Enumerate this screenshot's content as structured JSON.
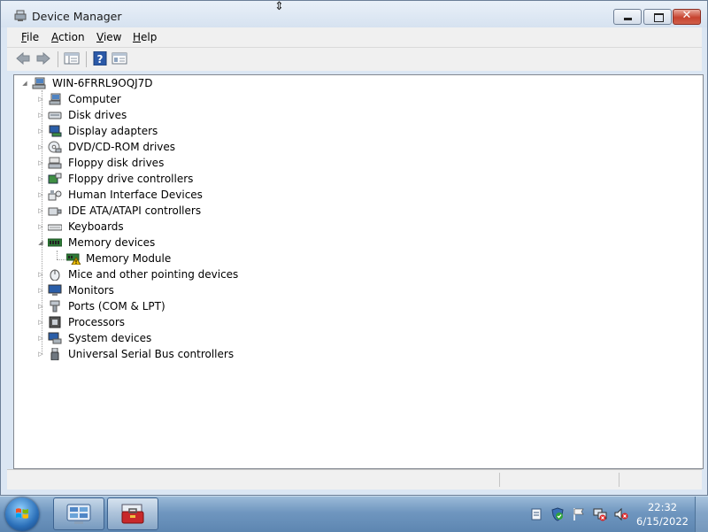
{
  "window": {
    "title": "Device Manager",
    "controls": {
      "minimize": "–",
      "maximize": "□",
      "close": "✕"
    }
  },
  "menu": [
    {
      "label_u": "F",
      "label_rest": "ile"
    },
    {
      "label_u": "A",
      "label_rest": "ction"
    },
    {
      "label_u": "V",
      "label_rest": "iew"
    },
    {
      "label_u": "H",
      "label_rest": "elp"
    }
  ],
  "toolbar": {
    "buttons": [
      "back-arrow-icon",
      "forward-arrow-icon",
      "show-hide-console-tree-icon",
      "help-icon",
      "properties-icon"
    ]
  },
  "tree": {
    "root": {
      "label": "WIN-6FRRL9OQJ7D",
      "icon": "computer-icon",
      "expanded": true
    },
    "categories": [
      {
        "label": "Computer",
        "icon": "computer-icon"
      },
      {
        "label": "Disk drives",
        "icon": "disk-drive-icon"
      },
      {
        "label": "Display adapters",
        "icon": "display-adapter-icon"
      },
      {
        "label": "DVD/CD-ROM drives",
        "icon": "dvd-drive-icon"
      },
      {
        "label": "Floppy disk drives",
        "icon": "floppy-disk-icon"
      },
      {
        "label": "Floppy drive controllers",
        "icon": "floppy-controller-icon"
      },
      {
        "label": "Human Interface Devices",
        "icon": "hid-icon"
      },
      {
        "label": "IDE ATA/ATAPI controllers",
        "icon": "ide-controller-icon"
      },
      {
        "label": "Keyboards",
        "icon": "keyboard-icon"
      },
      {
        "label": "Memory devices",
        "icon": "memory-icon",
        "expanded": true,
        "children": [
          {
            "label": "Memory Module",
            "icon": "memory-module-warning-icon"
          }
        ]
      },
      {
        "label": "Mice and other pointing devices",
        "icon": "mouse-icon"
      },
      {
        "label": "Monitors",
        "icon": "monitor-icon"
      },
      {
        "label": "Ports (COM & LPT)",
        "icon": "port-icon"
      },
      {
        "label": "Processors",
        "icon": "processor-icon"
      },
      {
        "label": "System devices",
        "icon": "system-devices-icon"
      },
      {
        "label": "Universal Serial Bus controllers",
        "icon": "usb-icon"
      }
    ]
  },
  "taskbar": {
    "clock": {
      "time": "22:32",
      "date": "6/15/2022"
    },
    "tray": [
      "action-center-icon",
      "security-shield-icon",
      "flag-icon",
      "network-disconnected-icon",
      "volume-muted-icon"
    ],
    "pinned": [
      "control-panel-icon",
      "device-manager-toolbox-icon"
    ]
  },
  "colors": {
    "titlebar": "#dbe6f3",
    "tree_bg": "#ffffff",
    "taskbar": "#6f96bf"
  }
}
